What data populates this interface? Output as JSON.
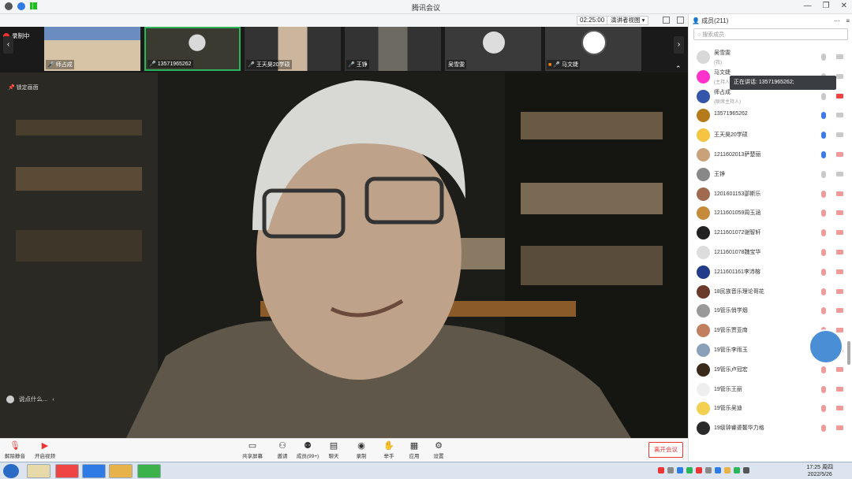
{
  "window": {
    "title": "腾讯会议"
  },
  "subbar": {
    "timer": "02:25:00",
    "view_mode": "演讲者视图 ▾"
  },
  "recording": {
    "label": "录制中"
  },
  "thumbnails": [
    {
      "name": "师占成",
      "bg": "#6b8cbe"
    },
    {
      "name": "13571965262",
      "bg": "#4a4a3c"
    },
    {
      "name": "王天昊20学硕",
      "bg": "#b9a58e"
    },
    {
      "name": "王铮",
      "bg": "#6d6a62"
    },
    {
      "name": "吴雪雯",
      "bg": "#3a3a3a"
    },
    {
      "name": "马文婕",
      "bg": "#3a3a3a"
    }
  ],
  "main": {
    "lock_label": "锁定画面",
    "chat_placeholder": "说点什么..."
  },
  "toolbar": {
    "unmute": "解除静音",
    "video": "开启视频",
    "share": "共享屏幕",
    "invite": "邀请",
    "members": "成员(99+)",
    "chat": "聊天",
    "record": "录制",
    "hand": "举手",
    "apps": "应用",
    "settings": "设置",
    "leave": "离开会议"
  },
  "panel": {
    "header": "成员(211)",
    "search_placeholder": "搜索成员",
    "speaking_tip": "正在讲话: 13571965262;"
  },
  "members": [
    {
      "name": "吴雪雯",
      "sub": "(我)",
      "av": "#d8d8d8",
      "mic": "#c9c9c9",
      "cam": "#c9c9c9"
    },
    {
      "name": "马文婕",
      "sub": "(主持人)",
      "av": "#f3c",
      "mic": "#c9c9c9",
      "cam": "#c9c9c9"
    },
    {
      "name": "师占成",
      "sub": "(联席主持人)",
      "av": "#35a",
      "mic": "#c9c9c9",
      "cam": "#e44"
    },
    {
      "name": "13571965262",
      "sub": "",
      "av": "#b57a1a",
      "mic": "#3b7bf0",
      "cam": "#c9c9c9"
    },
    {
      "name": "王天昊20学硕",
      "sub": "",
      "av": "#f5c542",
      "mic": "#3b7bf0",
      "cam": "#c9c9c9"
    },
    {
      "name": "1211602013萨楚丽",
      "sub": "",
      "av": "#c9a27a",
      "mic": "#3b7bf0",
      "cam": "#f29a9a"
    },
    {
      "name": "王铮",
      "sub": "",
      "av": "#888",
      "mic": "#c9c9c9",
      "cam": "#c9c9c9"
    },
    {
      "name": "1201601153邵斯乐",
      "sub": "",
      "av": "#a06a50",
      "mic": "#f29a9a",
      "cam": "#f29a9a"
    },
    {
      "name": "1211601059周玉涵",
      "sub": "",
      "av": "#c58a3a",
      "mic": "#f29a9a",
      "cam": "#f29a9a"
    },
    {
      "name": "1211601072谢智轩",
      "sub": "",
      "av": "#222",
      "mic": "#f29a9a",
      "cam": "#f29a9a"
    },
    {
      "name": "1211601078魏宝华",
      "sub": "",
      "av": "#ddd",
      "mic": "#f29a9a",
      "cam": "#f29a9a"
    },
    {
      "name": "1211601161李沛榕",
      "sub": "",
      "av": "#233c8a",
      "mic": "#f29a9a",
      "cam": "#f29a9a"
    },
    {
      "name": "18民族音乐理论哥花",
      "sub": "",
      "av": "#6a3b2a",
      "mic": "#f29a9a",
      "cam": "#f29a9a"
    },
    {
      "name": "19管乐俏学烟",
      "sub": "",
      "av": "#999",
      "mic": "#f29a9a",
      "cam": "#f29a9a"
    },
    {
      "name": "19管乐贾亚南",
      "sub": "",
      "av": "#c08060",
      "mic": "#f29a9a",
      "cam": "#f29a9a"
    },
    {
      "name": "19管乐李雨玉",
      "sub": "",
      "av": "#8aa0b8",
      "mic": "#f29a9a",
      "cam": "#f29a9a"
    },
    {
      "name": "19管乐卢冠宏",
      "sub": "",
      "av": "#3a2a1a",
      "mic": "#f29a9a",
      "cam": "#f29a9a"
    },
    {
      "name": "19管乐王丽",
      "sub": "",
      "av": "#eee",
      "mic": "#f29a9a",
      "cam": "#f29a9a"
    },
    {
      "name": "19管乐吴迪",
      "sub": "",
      "av": "#f2d050",
      "mic": "#f29a9a",
      "cam": "#f29a9a"
    },
    {
      "name": "19级钟睿婆鳌华力格",
      "sub": "",
      "av": "#2a2a2a",
      "mic": "#f29a9a",
      "cam": "#f29a9a"
    }
  ],
  "taskbar": {
    "time": "17:25 周四",
    "date": "2022/5/26"
  }
}
